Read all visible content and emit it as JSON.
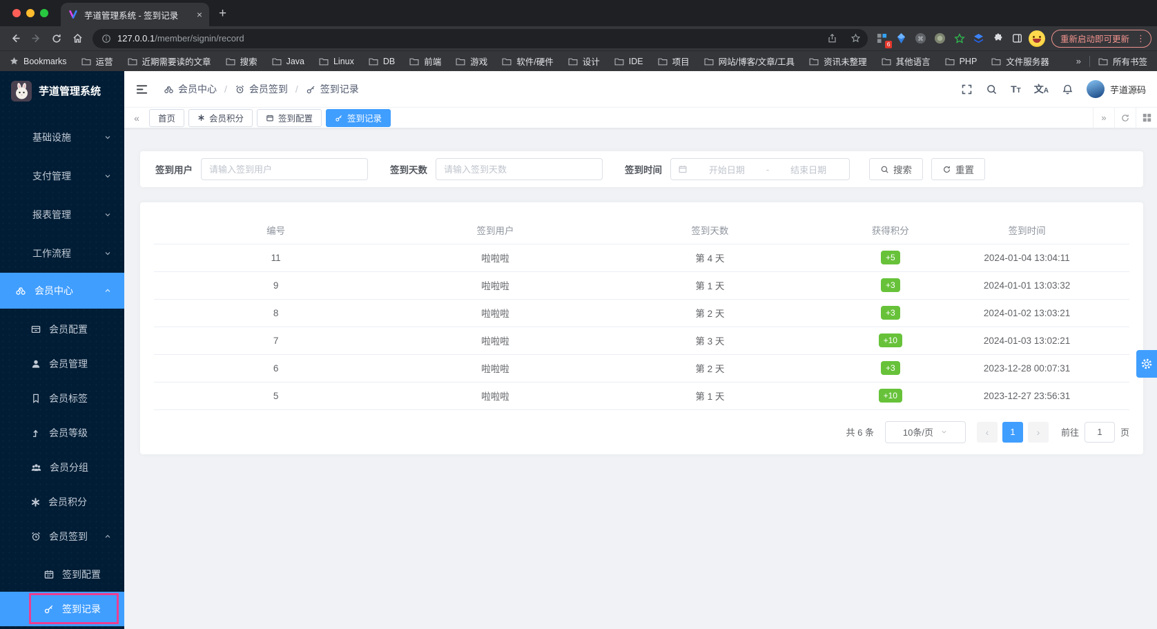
{
  "colors": {
    "accent": "#409eff",
    "success": "#67c23a",
    "sidebar_bg": "#001d35",
    "annotation": "#ed3d90"
  },
  "browser": {
    "tab_title": "芋道管理系统 - 签到记录",
    "close_glyph": "×",
    "new_tab_glyph": "+",
    "url_host": "127.0.0.1",
    "url_path": "/member/signin/record",
    "extension_badge": "6",
    "update_button": "重新启动即可更新",
    "kebab_glyph": "⋮",
    "bookmarks_label": "Bookmarks",
    "bookmark_folders": [
      "运营",
      "近期需要读的文章",
      "搜索",
      "Java",
      "Linux",
      "DB",
      "前端",
      "游戏",
      "软件/硬件",
      "设计",
      "IDE",
      "项目",
      "网站/博客/文章/工具",
      "资讯未整理",
      "其他语言",
      "PHP",
      "文件服务器"
    ],
    "overflow_glyph": "»",
    "all_bookmarks": "所有书签"
  },
  "sidebar": {
    "brand": "芋道管理系统",
    "groups": [
      {
        "label": "基础设施"
      },
      {
        "label": "支付管理"
      },
      {
        "label": "报表管理"
      },
      {
        "label": "工作流程"
      }
    ],
    "member_center": {
      "label": "会员中心"
    },
    "member_children": [
      {
        "label": "会员配置"
      },
      {
        "label": "会员管理"
      },
      {
        "label": "会员标签"
      },
      {
        "label": "会员等级"
      },
      {
        "label": "会员分组"
      },
      {
        "label": "会员积分"
      }
    ],
    "signin_group": {
      "label": "会员签到"
    },
    "signin_children": [
      {
        "label": "签到配置"
      },
      {
        "label": "签到记录"
      }
    ]
  },
  "header": {
    "breadcrumb": [
      {
        "label": "会员中心"
      },
      {
        "label": "会员签到"
      },
      {
        "label": "签到记录"
      }
    ],
    "separator": "/",
    "user_name": "芋道源码"
  },
  "tabsbar": {
    "left_glyph": "«",
    "right_glyph": "»",
    "tabs": [
      {
        "label": "首页"
      },
      {
        "label": "会员积分"
      },
      {
        "label": "签到配置"
      },
      {
        "label": "签到记录"
      }
    ]
  },
  "filters": {
    "user_label": "签到用户",
    "user_placeholder": "请输入签到用户",
    "days_label": "签到天数",
    "days_placeholder": "请输入签到天数",
    "time_label": "签到时间",
    "date_start_placeholder": "开始日期",
    "date_separator": "-",
    "date_end_placeholder": "结束日期",
    "search_label": "搜索",
    "reset_label": "重置"
  },
  "table": {
    "columns": [
      "编号",
      "签到用户",
      "签到天数",
      "获得积分",
      "签到时间"
    ],
    "rows": [
      {
        "id": "11",
        "user": "啦啦啦",
        "day": "第 4 天",
        "points": "+5",
        "time": "2024-01-04 13:04:11"
      },
      {
        "id": "9",
        "user": "啦啦啦",
        "day": "第 1 天",
        "points": "+3",
        "time": "2024-01-01 13:03:32"
      },
      {
        "id": "8",
        "user": "啦啦啦",
        "day": "第 2 天",
        "points": "+3",
        "time": "2024-01-02 13:03:21"
      },
      {
        "id": "7",
        "user": "啦啦啦",
        "day": "第 3 天",
        "points": "+10",
        "time": "2024-01-03 13:02:21"
      },
      {
        "id": "6",
        "user": "啦啦啦",
        "day": "第 2 天",
        "points": "+3",
        "time": "2023-12-28 00:07:31"
      },
      {
        "id": "5",
        "user": "啦啦啦",
        "day": "第 1 天",
        "points": "+10",
        "time": "2023-12-27 23:56:31"
      }
    ]
  },
  "pagination": {
    "total": "共 6 条",
    "page_size": "10条/页",
    "prev_glyph": "‹",
    "current_page": "1",
    "next_glyph": "›",
    "goto_label": "前往",
    "goto_value": "1",
    "page_unit": "页"
  }
}
